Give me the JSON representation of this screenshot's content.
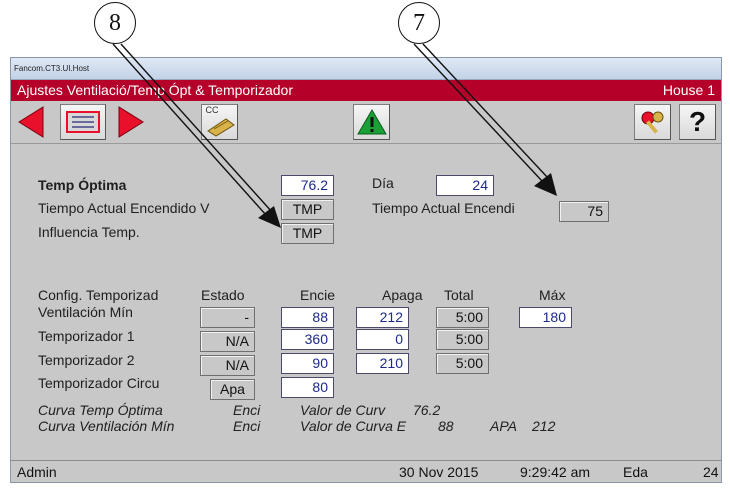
{
  "callouts": {
    "c8": "8",
    "c7": "7"
  },
  "window": {
    "host_title": "Fancom.CT3.UI.Host"
  },
  "header": {
    "title": "Ajustes Ventilació/Temp Ópt & Temporizador",
    "house": "House 1"
  },
  "toolbar": {
    "cc_label": "CC",
    "help_label": "?",
    "icons": [
      "arrow-left-icon",
      "list-icon",
      "arrow-right-icon",
      "card-reader-icon",
      "warning-icon",
      "keys-icon",
      "help-icon"
    ],
    "accent_red": "#e8102a",
    "warning_green": "#1aa037"
  },
  "settings": {
    "temp_optima_label": "Temp Óptima",
    "temp_optima_value": "76.2",
    "dia_label": "Día",
    "dia_value": "24",
    "tiempo_actual_vent_label": "Tiempo Actual Encendido V",
    "tiempo_actual_vent_value": "TMP",
    "tiempo_actual_enc_label": "Tiempo Actual Encendi",
    "tiempo_actual_enc_value": "75",
    "influencia_label": "Influencia Temp.",
    "influencia_value": "TMP"
  },
  "timers": {
    "headers": {
      "config": "Config. Temporizad",
      "estado": "Estado",
      "encie": "Encie",
      "apaga": "Apaga",
      "total": "Total",
      "max": "Máx"
    },
    "rows": [
      {
        "name": "Ventilación Mín",
        "estado": "-",
        "encie": "88",
        "apaga": "212",
        "total": "5:00",
        "max": "180"
      },
      {
        "name": "Temporizador 1",
        "estado": "N/A",
        "encie": "360",
        "apaga": "0",
        "total": "5:00"
      },
      {
        "name": "Temporizador 2",
        "estado": "N/A",
        "encie": "90",
        "apaga": "210",
        "total": "5:00"
      },
      {
        "name": "Temporizador Circu",
        "estado": "Apa",
        "encie": "80"
      }
    ]
  },
  "curves": [
    {
      "name": "Curva Temp Óptima",
      "state": "Enci",
      "label": "Valor de Curv",
      "value": "76.2"
    },
    {
      "name": "Curva Ventilación Mín",
      "state": "Enci",
      "label": "Valor de Curva E",
      "value": "88",
      "apa_label": "APA",
      "apa_value": "212"
    }
  ],
  "status": {
    "user": "Admin",
    "date": "30 Nov 2015",
    "time": "9:29:42 am",
    "mode": "Eda",
    "day": "24"
  }
}
